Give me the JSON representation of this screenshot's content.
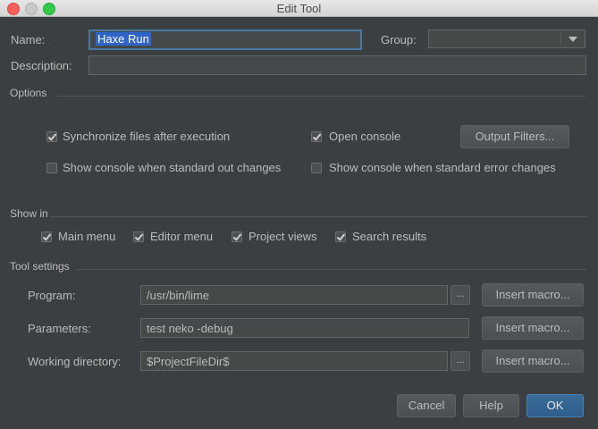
{
  "window": {
    "title": "Edit Tool"
  },
  "form": {
    "name_label": "Name:",
    "name_value": "Haxe Run",
    "group_label": "Group:",
    "group_value": "",
    "description_label": "Description:",
    "description_value": ""
  },
  "options": {
    "section": "Options",
    "sync_label": "Synchronize files after execution",
    "open_console_label": "Open console",
    "output_filters_label": "Output Filters...",
    "show_console_out_label": "Show console when standard out changes",
    "show_console_err_label": "Show console when standard error changes"
  },
  "show_in": {
    "section": "Show in",
    "main_menu": "Main menu",
    "editor_menu": "Editor menu",
    "project_views": "Project views",
    "search_results": "Search results"
  },
  "tool_settings": {
    "section": "Tool settings",
    "program_label": "Program:",
    "program_value": "/usr/bin/lime",
    "parameters_label": "Parameters:",
    "parameters_value": "test neko -debug",
    "working_dir_label": "Working directory:",
    "working_dir_value": "$ProjectFileDir$",
    "insert_macro_label": "Insert macro...",
    "browse_label": "..."
  },
  "footer": {
    "cancel_label": "Cancel",
    "help_label": "Help",
    "ok_label": "OK"
  },
  "colors": {
    "background": "#3c3f41",
    "focus_border": "#467aa4",
    "selection": "#2f65ca",
    "primary_button": "#2f5e8b"
  }
}
